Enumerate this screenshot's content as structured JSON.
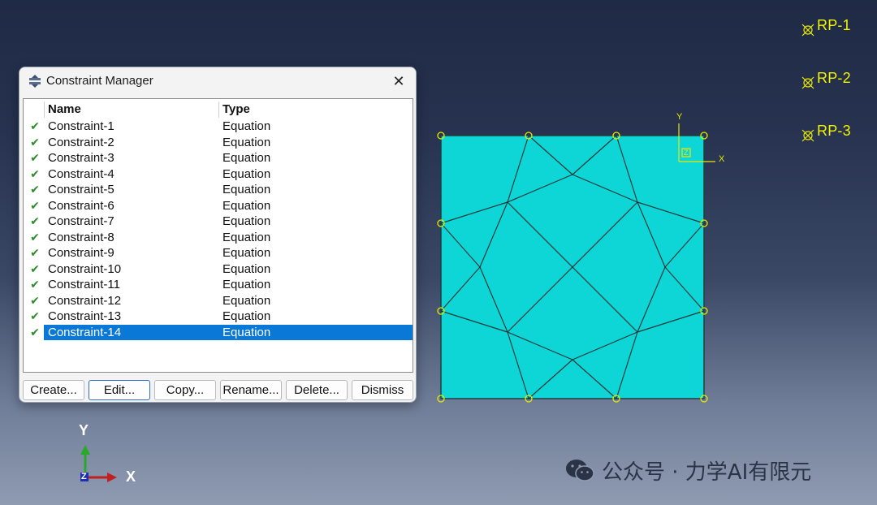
{
  "dialog": {
    "title": "Constraint Manager",
    "close_glyph": "✕",
    "columns": {
      "name": "Name",
      "type": "Type"
    },
    "rows": [
      {
        "name": "Constraint-1",
        "type": "Equation",
        "checked": true
      },
      {
        "name": "Constraint-2",
        "type": "Equation",
        "checked": true
      },
      {
        "name": "Constraint-3",
        "type": "Equation",
        "checked": true
      },
      {
        "name": "Constraint-4",
        "type": "Equation",
        "checked": true
      },
      {
        "name": "Constraint-5",
        "type": "Equation",
        "checked": true
      },
      {
        "name": "Constraint-6",
        "type": "Equation",
        "checked": true
      },
      {
        "name": "Constraint-7",
        "type": "Equation",
        "checked": true
      },
      {
        "name": "Constraint-8",
        "type": "Equation",
        "checked": true
      },
      {
        "name": "Constraint-9",
        "type": "Equation",
        "checked": true
      },
      {
        "name": "Constraint-10",
        "type": "Equation",
        "checked": true
      },
      {
        "name": "Constraint-11",
        "type": "Equation",
        "checked": true
      },
      {
        "name": "Constraint-12",
        "type": "Equation",
        "checked": true
      },
      {
        "name": "Constraint-13",
        "type": "Equation",
        "checked": true
      },
      {
        "name": "Constraint-14",
        "type": "Equation",
        "checked": true,
        "selected": true
      }
    ],
    "buttons": {
      "create": "Create...",
      "edit": "Edit...",
      "copy": "Copy...",
      "rename": "Rename...",
      "delete": "Delete...",
      "dismiss": "Dismiss"
    }
  },
  "viewport": {
    "reference_points": [
      "RP-1",
      "RP-2",
      "RP-3"
    ],
    "local_triad": {
      "x": "X",
      "y": "Y",
      "z": "Z"
    },
    "global_triad": {
      "x": "X",
      "y": "Y",
      "z": "Z"
    },
    "colors": {
      "mesh_fill": "#0fd6d6",
      "mesh_edge": "#1a3a3a",
      "node_marker": "#e8e800",
      "rp_label": "#f2f200",
      "selection": "#0a78d7"
    }
  },
  "watermark": {
    "text": "公众号 · 力学AI有限元",
    "icon": "wechat-icon"
  }
}
